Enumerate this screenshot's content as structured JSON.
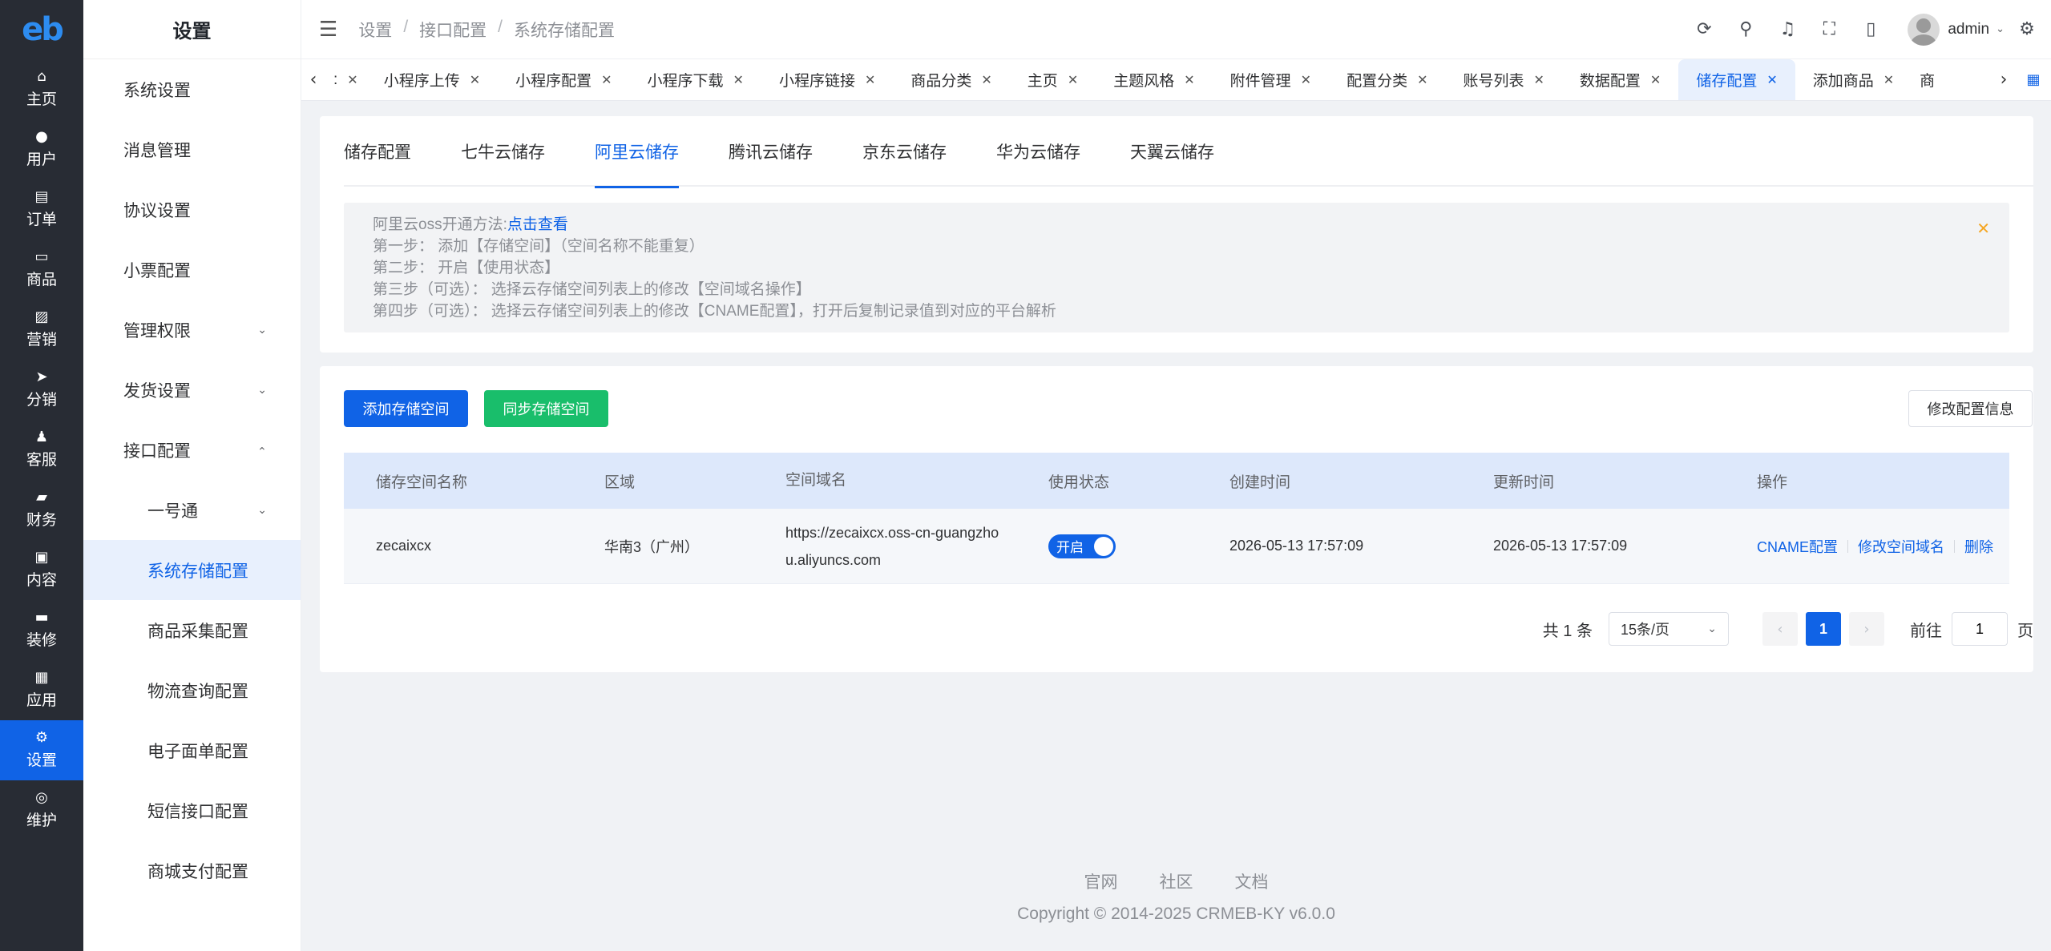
{
  "rail": {
    "logo": "eb",
    "items": [
      {
        "icon": "⌂",
        "label": "主页"
      },
      {
        "icon": "●",
        "label": "用户"
      },
      {
        "icon": "▤",
        "label": "订单"
      },
      {
        "icon": "▭",
        "label": "商品"
      },
      {
        "icon": "▨",
        "label": "营销"
      },
      {
        "icon": "➤",
        "label": "分销"
      },
      {
        "icon": "♟",
        "label": "客服"
      },
      {
        "icon": "▰",
        "label": "财务"
      },
      {
        "icon": "▣",
        "label": "内容"
      },
      {
        "icon": "▬",
        "label": "装修"
      },
      {
        "icon": "▦",
        "label": "应用"
      },
      {
        "icon": "⚙",
        "label": "设置"
      },
      {
        "icon": "◎",
        "label": "维护"
      }
    ]
  },
  "sidebar": {
    "title": "设置",
    "items": [
      {
        "label": "系统设置"
      },
      {
        "label": "消息管理"
      },
      {
        "label": "协议设置"
      },
      {
        "label": "小票配置"
      },
      {
        "label": "管理权限"
      },
      {
        "label": "发货设置"
      },
      {
        "label": "接口配置"
      },
      {
        "label": "一号通"
      },
      {
        "label": "系统存储配置"
      },
      {
        "label": "商品采集配置"
      },
      {
        "label": "物流查询配置"
      },
      {
        "label": "电子面单配置"
      },
      {
        "label": "短信接口配置"
      },
      {
        "label": "商城支付配置"
      }
    ]
  },
  "header": {
    "menu_icon": "☰",
    "breadcrumbs": [
      "设置",
      "接口配置",
      "系统存储配置"
    ],
    "breadcrumb_sep": "/",
    "icons": [
      "⟳",
      "⚲",
      "♫",
      "⛶",
      "▯"
    ],
    "username": "admin",
    "chevron": "⌄",
    "settings_icon": "⚙"
  },
  "tagsbar": {
    "left_arrow": "‹",
    "right_arrow": "›",
    "close": "✕",
    "grid_icon": "▦",
    "first_cut": ":",
    "last_cut": "商",
    "tags": [
      "小程序上传",
      "小程序配置",
      "小程序下载",
      "小程序链接",
      "商品分类",
      "主页",
      "主题风格",
      "附件管理",
      "配置分类",
      "账号列表",
      "数据配置",
      "储存配置",
      "添加商品"
    ]
  },
  "storage_tabs": [
    "储存配置",
    "七牛云储存",
    "阿里云储存",
    "腾讯云储存",
    "京东云储存",
    "华为云储存",
    "天翼云储存"
  ],
  "notice": {
    "line0_prefix": "阿里云oss开通方法:",
    "line0_link": "点击查看",
    "lines": [
      "第一步： 添加【存储空间】（空间名称不能重复）",
      "第二步： 开启【使用状态】",
      "第三步（可选）： 选择云存储空间列表上的修改【空间域名操作】",
      "第四步（可选）： 选择云存储空间列表上的修改【CNAME配置】，打开后复制记录值到对应的平台解析"
    ],
    "close": "✕"
  },
  "buttons": {
    "add": "添加存储空间",
    "sync": "同步存储空间",
    "edit_config": "修改配置信息"
  },
  "table": {
    "headers": [
      "储存空间名称",
      "区域",
      "空间域名",
      "使用状态",
      "创建时间",
      "更新时间",
      "操作"
    ],
    "rows": [
      {
        "name": "zecaixcx",
        "region": "华南3（广州）",
        "domain": "https://zecaixcx.oss-cn-guangzhou.aliyuncs.com",
        "status": "开启",
        "created": "2026-05-13 17:57:09",
        "updated": "2026-05-13 17:57:09",
        "ops": [
          "CNAME配置",
          "修改空间域名",
          "删除"
        ]
      }
    ]
  },
  "pager": {
    "total": "共 1 条",
    "page_size": "15条/页",
    "size_chevron": "⌄",
    "prev": "‹",
    "current": "1",
    "next": "›",
    "goto_prefix": "前往",
    "goto_value": "1",
    "goto_suffix": "页"
  },
  "footer": {
    "links": [
      "官网",
      "社区",
      "文档"
    ],
    "copyright": "Copyright © 2014-2025 CRMEB-KY v6.0.0"
  },
  "colors": {
    "primary": "#1063e6",
    "success": "#19be6b",
    "rail_bg": "#282c34",
    "warning": "#f5a623"
  }
}
